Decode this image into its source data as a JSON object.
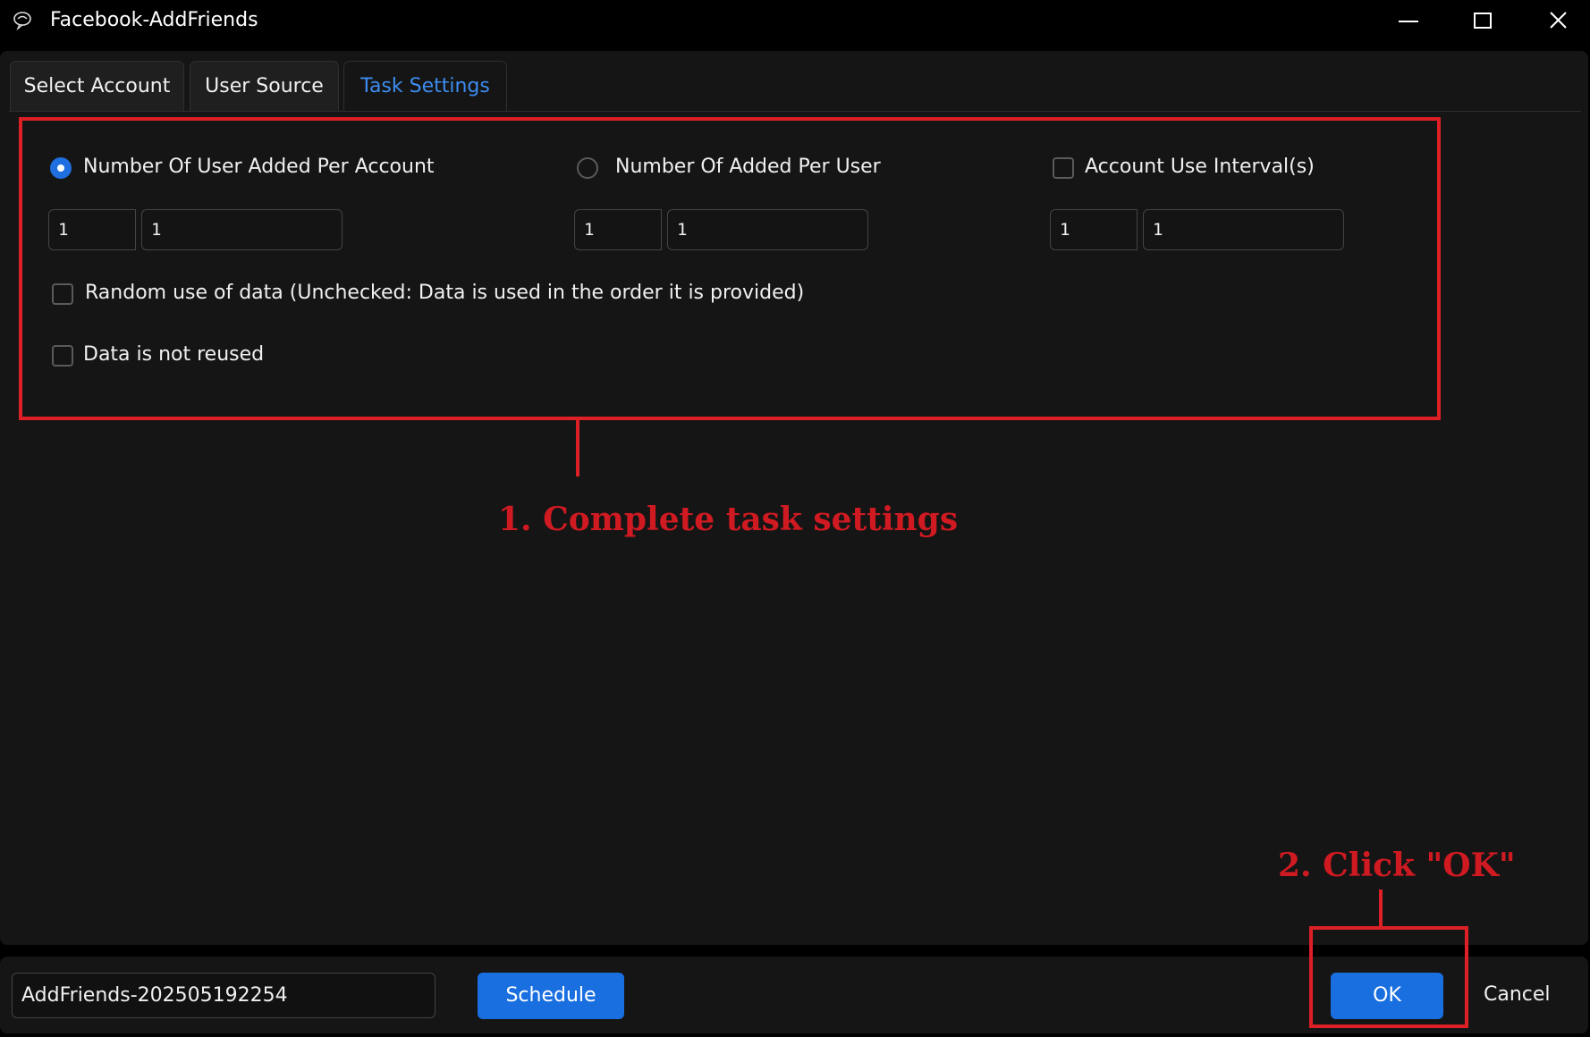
{
  "window": {
    "title": "Facebook-AddFriends",
    "icons": [
      "app-icon",
      "minimize-icon",
      "maximize-icon",
      "close-icon"
    ]
  },
  "tabs": [
    {
      "label": "Select Account",
      "active": false
    },
    {
      "label": "User Source",
      "active": false
    },
    {
      "label": "Task Settings",
      "active": true
    }
  ],
  "settings": {
    "per_account": {
      "label": "Number Of User Added Per Account",
      "selected": true,
      "min": "1",
      "max": "1"
    },
    "per_user": {
      "label": "Number Of Added Per  User",
      "selected": false,
      "min": "1",
      "max": "1"
    },
    "interval": {
      "label": "Account Use Interval(s)",
      "checked": false,
      "min": "1",
      "max": "1"
    },
    "random_use": {
      "label": "Random use of data (Unchecked: Data is used in the order it is provided)",
      "checked": false
    },
    "not_reused": {
      "label": "Data is not reused",
      "checked": false
    }
  },
  "annotations": {
    "step1": "1. Complete task settings",
    "step2": "2. Click \"OK\"",
    "color": "#dd1f26"
  },
  "footer": {
    "task_name": "AddFriends-202505192254",
    "schedule_label": "Schedule",
    "ok_label": "OK",
    "cancel_label": "Cancel"
  },
  "colors": {
    "accent": "#1a6fe0",
    "active_tab": "#3d8cf0",
    "background": "#151515"
  }
}
